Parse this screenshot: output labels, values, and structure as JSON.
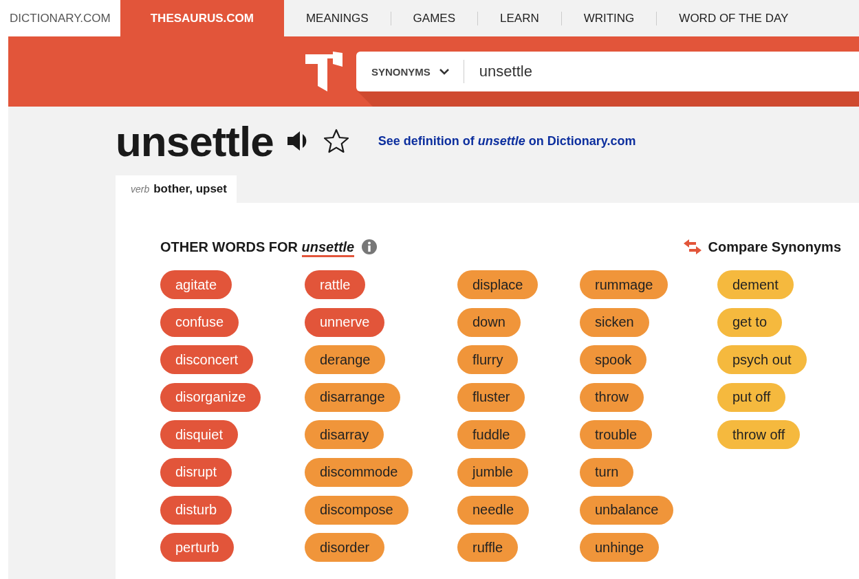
{
  "nav": {
    "tabs": [
      {
        "label": "DICTIONARY.COM",
        "selected": false,
        "kind": "site"
      },
      {
        "label": "THESAURUS.COM",
        "selected": true,
        "kind": "site"
      },
      {
        "label": "MEANINGS",
        "selected": false,
        "kind": "menu"
      },
      {
        "label": "GAMES",
        "selected": false,
        "kind": "menu"
      },
      {
        "label": "LEARN",
        "selected": false,
        "kind": "menu"
      },
      {
        "label": "WRITING",
        "selected": false,
        "kind": "menu"
      },
      {
        "label": "WORD OF THE DAY",
        "selected": false,
        "kind": "menu"
      }
    ]
  },
  "search": {
    "mode": "SYNONYMS",
    "value": "unsettle"
  },
  "entry": {
    "word": "unsettle",
    "definition_link": "See definition of *unsettle* on Dictionary.com"
  },
  "senses": [
    {
      "pos": "verb",
      "label": "bother, upset",
      "selected": true
    }
  ],
  "synonyms": {
    "heading": "OTHER WORDS FOR *unsettle*",
    "compare": "Compare Synonyms",
    "columns": [
      [
        {
          "word": "agitate",
          "color": "#e2553a"
        },
        {
          "word": "confuse",
          "color": "#e2553a"
        },
        {
          "word": "disconcert",
          "color": "#e2553a"
        },
        {
          "word": "disorganize",
          "color": "#e2553a"
        },
        {
          "word": "disquiet",
          "color": "#e2553a"
        },
        {
          "word": "disrupt",
          "color": "#e2553a"
        },
        {
          "word": "disturb",
          "color": "#e2553a"
        },
        {
          "word": "perturb",
          "color": "#e2553a"
        }
      ],
      [
        {
          "word": "rattle",
          "color": "#e2553a"
        },
        {
          "word": "unnerve",
          "color": "#e2553a"
        },
        {
          "word": "derange",
          "color": "#f0953a"
        },
        {
          "word": "disarrange",
          "color": "#f0953a"
        },
        {
          "word": "disarray",
          "color": "#f0953a"
        },
        {
          "word": "discommode",
          "color": "#f0953a"
        },
        {
          "word": "discompose",
          "color": "#f0953a"
        },
        {
          "word": "disorder",
          "color": "#f0953a"
        }
      ],
      [
        {
          "word": "displace",
          "color": "#f0953a"
        },
        {
          "word": "down",
          "color": "#f0953a"
        },
        {
          "word": "flurry",
          "color": "#f0953a"
        },
        {
          "word": "fluster",
          "color": "#f0953a"
        },
        {
          "word": "fuddle",
          "color": "#f0953a"
        },
        {
          "word": "jumble",
          "color": "#f0953a"
        },
        {
          "word": "needle",
          "color": "#f0953a"
        },
        {
          "word": "ruffle",
          "color": "#f0953a"
        }
      ],
      [
        {
          "word": "rummage",
          "color": "#f0953a"
        },
        {
          "word": "sicken",
          "color": "#f0953a"
        },
        {
          "word": "spook",
          "color": "#f0953a"
        },
        {
          "word": "throw",
          "color": "#f0953a"
        },
        {
          "word": "trouble",
          "color": "#f0953a"
        },
        {
          "word": "turn",
          "color": "#f0953a"
        },
        {
          "word": "unbalance",
          "color": "#f0953a"
        },
        {
          "word": "unhinge",
          "color": "#f0953a"
        }
      ],
      [
        {
          "word": "dement",
          "color": "#f5b93e"
        },
        {
          "word": "get to",
          "color": "#f5b93e"
        },
        {
          "word": "psych out",
          "color": "#f5b93e"
        },
        {
          "word": "put off",
          "color": "#f5b93e"
        },
        {
          "word": "throw off",
          "color": "#f5b93e"
        }
      ]
    ]
  }
}
